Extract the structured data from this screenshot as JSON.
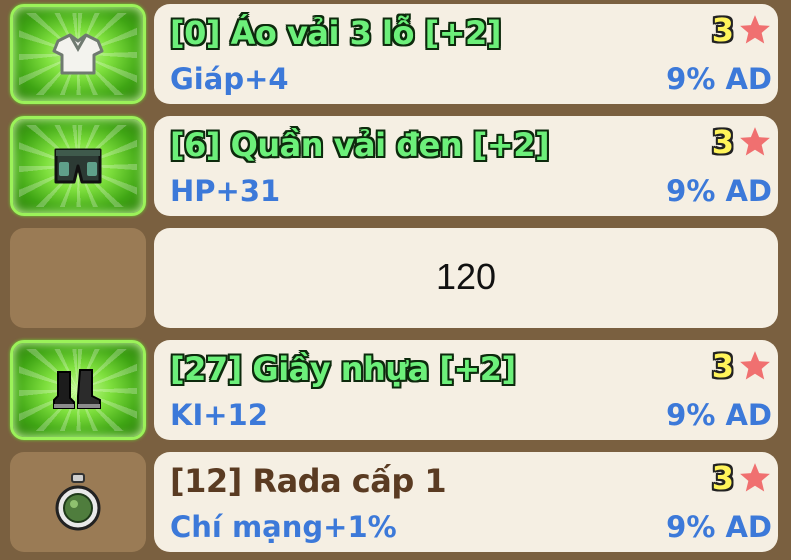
{
  "items": [
    {
      "name": "[0] Áo vải 3 lỗ [+2]",
      "stat": "Giáp+4",
      "percent": "9% AD",
      "stars": "3",
      "icon": "shirt-icon"
    },
    {
      "name": "[6] Quần vải đen [+2]",
      "stat": "HP+31",
      "percent": "9% AD",
      "stars": "3",
      "icon": "pants-icon"
    },
    {
      "empty_text": "120"
    },
    {
      "name": "[27] Giầy nhựa [+2]",
      "stat": "KI+12",
      "percent": "9% AD",
      "stars": "3",
      "icon": "boots-icon"
    },
    {
      "name": "[12] Rada cấp 1",
      "stat": "Chí mạng+1%",
      "percent": "9% AD",
      "stars": "3",
      "icon": "radar-icon"
    }
  ],
  "colors": {
    "glow_green": "#7fe03e",
    "name_green": "#6cf07a",
    "name_brown": "#5a3b22",
    "stat_blue": "#3c79d9",
    "star_red": "#f07070",
    "card_bg": "#f5efe3",
    "page_bg": "#7a6040"
  }
}
